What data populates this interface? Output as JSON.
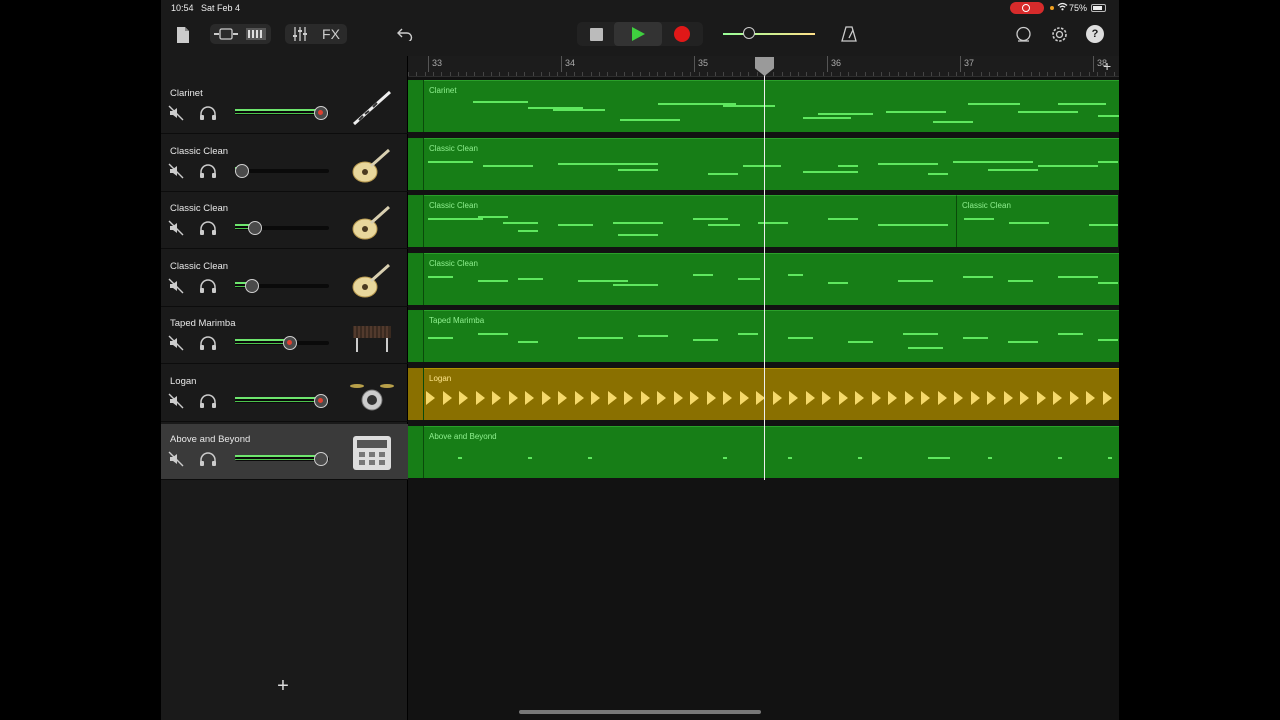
{
  "status": {
    "time": "10:54",
    "date": "Sat Feb 4",
    "battery": "75%"
  },
  "toolbar": {
    "fx_label": "FX"
  },
  "ruler": {
    "bars": [
      "33",
      "34",
      "35",
      "36",
      "37",
      "38"
    ]
  },
  "tracks": [
    {
      "name": "Clarinet",
      "instrument": "clarinet",
      "volume": 0.94,
      "red": true
    },
    {
      "name": "Classic Clean",
      "instrument": "guitar",
      "volume": 0.08,
      "red": false
    },
    {
      "name": "Classic Clean",
      "instrument": "guitar",
      "volume": 0.22,
      "red": false
    },
    {
      "name": "Classic Clean",
      "instrument": "guitar",
      "volume": 0.18,
      "red": false
    },
    {
      "name": "Taped Marimba",
      "instrument": "marimba",
      "volume": 0.6,
      "red": true
    },
    {
      "name": "Logan",
      "instrument": "drums",
      "volume": 0.94,
      "red": true
    },
    {
      "name": "Above and Beyond",
      "instrument": "beat-machine",
      "volume": 0.94,
      "red": false
    }
  ],
  "regions": [
    [
      {
        "label": "Clarinet"
      }
    ],
    [
      {
        "label": "Classic Clean"
      }
    ],
    [
      {
        "label": "Classic Clean"
      },
      {
        "label": "Classic Clean"
      }
    ],
    [
      {
        "label": "Classic Clean"
      }
    ],
    [
      {
        "label": "Taped Marimba"
      }
    ],
    [
      {
        "label": "Logan"
      }
    ],
    [
      {
        "label": "Above and Beyond"
      }
    ]
  ],
  "colors": {
    "midi_region": "#177e17",
    "audio_region": "#8a7000",
    "note": "#5fe85f",
    "record": "#e01818",
    "play": "#3fcf3f"
  }
}
